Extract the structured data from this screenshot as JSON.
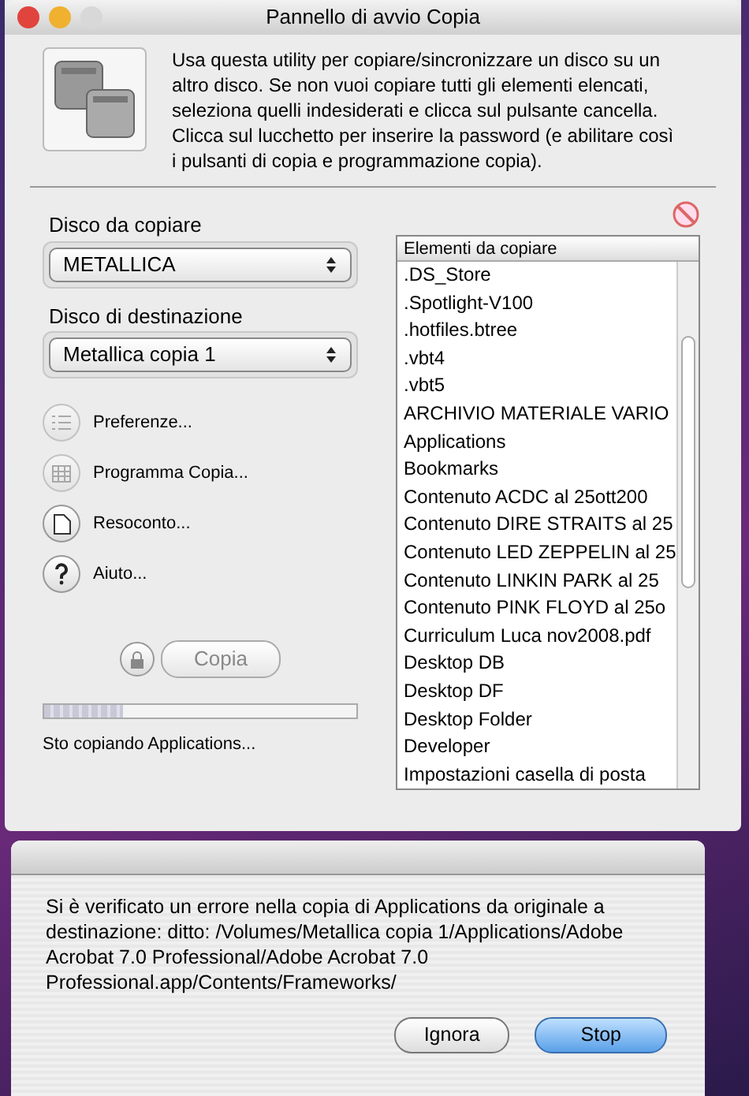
{
  "window": {
    "title": "Pannello di avvio Copia",
    "description": "Usa questa utility per copiare/sincronizzare un disco su un altro disco.  Se non vuoi copiare tutti gli elementi elencati, seleziona quelli indesiderati e clicca sul pulsante cancella. Clicca sul lucchetto per inserire la password (e abilitare così i pulsanti di copia e programmazione copia)."
  },
  "source": {
    "label": "Disco da copiare",
    "value": "METALLICA"
  },
  "destination": {
    "label": "Disco di destinazione",
    "value": "Metallica copia 1"
  },
  "actions": [
    {
      "label": "Preferenze...",
      "disabled": true
    },
    {
      "label": "Programma Copia...",
      "disabled": true
    },
    {
      "label": "Resoconto...",
      "disabled": false
    },
    {
      "label": "Aiuto...",
      "disabled": false
    }
  ],
  "copy_button": {
    "label": "Copia",
    "disabled": true
  },
  "progress": {
    "level": 0.25,
    "status": "Sto copiando Applications..."
  },
  "items": {
    "column": "Elementi da copiare",
    "rows": [
      ".DS_Store",
      ".Spotlight-V100",
      ".hotfiles.btree",
      ".vbt4",
      ".vbt5",
      "ARCHIVIO MATERIALE VARIO",
      "Applications",
      "Bookmarks",
      "Contenuto ACDC al 25ott200",
      "Contenuto DIRE STRAITS al 25",
      "Contenuto LED ZEPPELIN al 25",
      "Contenuto LINKIN PARK al 25",
      "Contenuto PINK FLOYD al 25o",
      "Curriculum Luca nov2008.pdf",
      "Desktop DB",
      "Desktop DF",
      "Desktop Folder",
      "Developer",
      "Impostazioni casella di posta"
    ]
  },
  "dialog": {
    "message": "Si è verificato un errore nella copia di Applications da originale a destinazione: ditto: /Volumes/Metallica copia 1/Applications/Adobe Acrobat 7.0 Professional/Adobe Acrobat 7.0 Professional.app/Contents/Frameworks/",
    "buttons": [
      {
        "label": "Ignora",
        "default": false
      },
      {
        "label": "Stop",
        "default": true
      }
    ]
  }
}
